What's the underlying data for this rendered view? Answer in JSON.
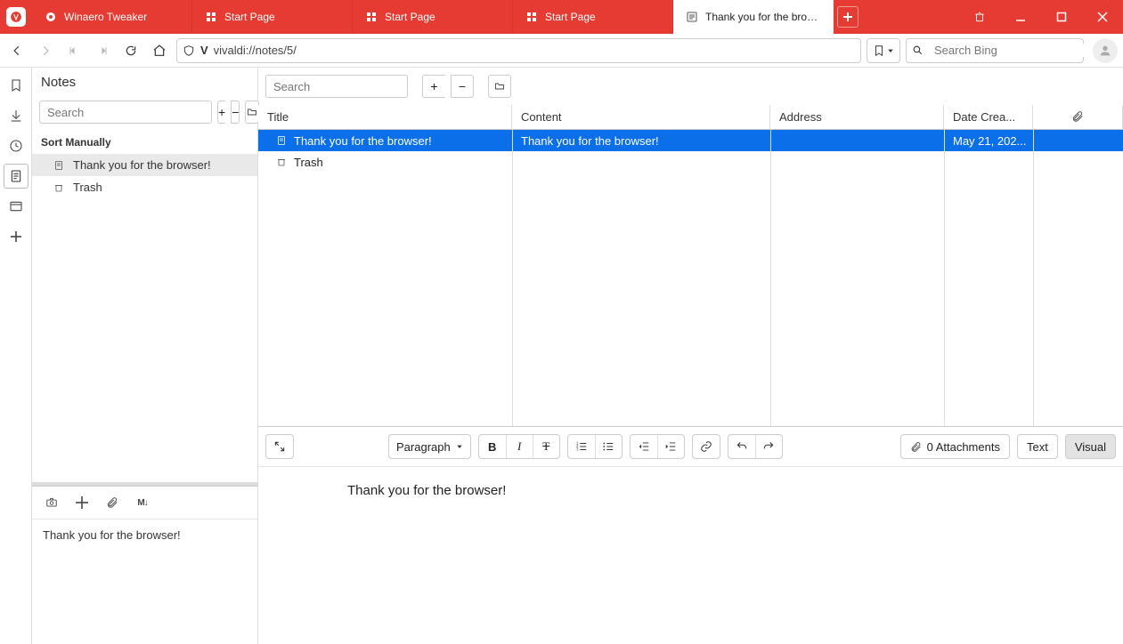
{
  "tabs": [
    {
      "label": "Winaero Tweaker"
    },
    {
      "label": "Start Page"
    },
    {
      "label": "Start Page"
    },
    {
      "label": "Start Page"
    },
    {
      "label": "Thank you for the browser!"
    }
  ],
  "address": {
    "url": "vivaldi://notes/5/"
  },
  "search": {
    "placeholder": "Search Bing"
  },
  "sidebar": {
    "title": "Notes",
    "search_placeholder": "Search",
    "sort_label": "Sort Manually",
    "items": [
      {
        "label": "Thank you for the browser!"
      },
      {
        "label": "Trash"
      }
    ],
    "preview_text": "Thank you for the browser!"
  },
  "content": {
    "search_placeholder": "Search",
    "columns": {
      "title": "Title",
      "content": "Content",
      "address": "Address",
      "date": "Date Crea..."
    },
    "rows": [
      {
        "title": "Thank you for the browser!",
        "content": "Thank you for the browser!",
        "address": "",
        "date": "May 21, 202..."
      },
      {
        "title": "Trash"
      }
    ]
  },
  "editor": {
    "paragraph_label": "Paragraph",
    "attachments_label": "0 Attachments",
    "mode_text": "Text",
    "mode_visual": "Visual",
    "body": "Thank you for the browser!"
  }
}
